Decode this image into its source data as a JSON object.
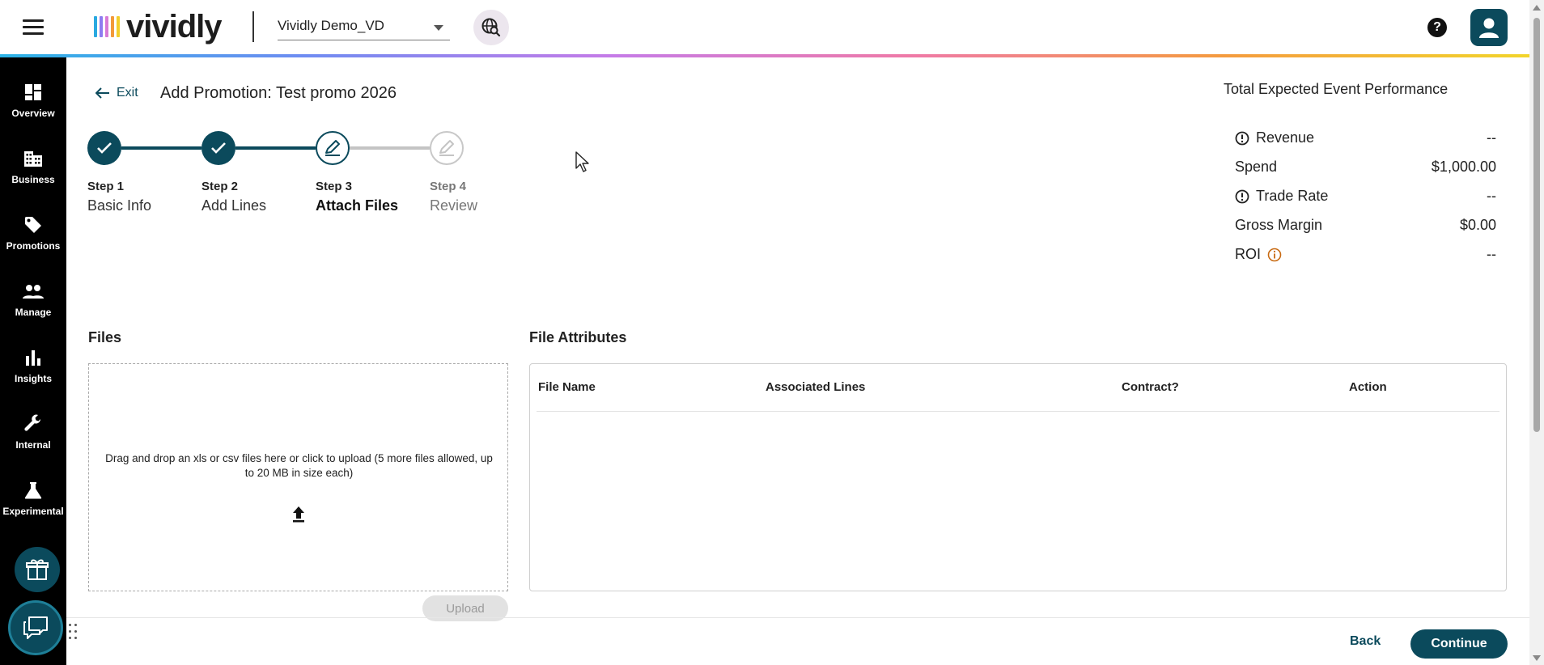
{
  "header": {
    "brand": "vividly",
    "brand_bar_colors": [
      "#2aa9e0",
      "#8e7cf0",
      "#d87ad6",
      "#f29a3a",
      "#f2cf2b"
    ],
    "workspace_value": "Vividly Demo_VD",
    "help_symbol": "?",
    "icons": {
      "menu": "hamburger-icon",
      "globe": "globe-search-icon",
      "help": "help-icon",
      "user": "user-icon"
    }
  },
  "sidebar": {
    "items": [
      {
        "label": "Overview",
        "icon": "dashboard-icon"
      },
      {
        "label": "Business",
        "icon": "building-icon"
      },
      {
        "label": "Promotions",
        "icon": "tag-icon"
      },
      {
        "label": "Manage",
        "icon": "people-icon"
      },
      {
        "label": "Insights",
        "icon": "bar-chart-icon"
      },
      {
        "label": "Internal",
        "icon": "wrench-icon"
      },
      {
        "label": "Experimental",
        "icon": "flask-icon"
      }
    ],
    "gift_icon": "gift-icon",
    "chat_icon": "chat-icon"
  },
  "main": {
    "exit_label": "Exit",
    "title": "Add Promotion: Test promo 2026",
    "steps": [
      {
        "number": "Step 1",
        "name": "Basic Info",
        "state": "done"
      },
      {
        "number": "Step 2",
        "name": "Add Lines",
        "state": "done"
      },
      {
        "number": "Step 3",
        "name": "Attach Files",
        "state": "active"
      },
      {
        "number": "Step 4",
        "name": "Review",
        "state": "todo"
      }
    ],
    "performance": {
      "title": "Total Expected Event Performance",
      "rows": [
        {
          "label": "Revenue",
          "value": "--",
          "icon": "alert-circle-icon"
        },
        {
          "label": "Spend",
          "value": "$1,000.00",
          "icon": ""
        },
        {
          "label": "Trade Rate",
          "value": "--",
          "icon": "alert-circle-icon"
        },
        {
          "label": "Gross Margin",
          "value": "$0.00",
          "icon": ""
        },
        {
          "label": "ROI",
          "value": "--",
          "icon": "info-icon"
        }
      ]
    },
    "files": {
      "title": "Files",
      "dropzone_text": "Drag and drop an xls or csv files here or click to upload (5 more files allowed, up to 20 MB in size each)",
      "upload_label": "Upload"
    },
    "attributes": {
      "title": "File Attributes",
      "columns": [
        "File Name",
        "Associated Lines",
        "Contract?",
        "Action"
      ]
    }
  },
  "footer": {
    "back_label": "Back",
    "continue_label": "Continue"
  },
  "colors": {
    "primary": "#0b4a5c",
    "sidebar_bg": "#000000",
    "warning": "#c86a12"
  }
}
